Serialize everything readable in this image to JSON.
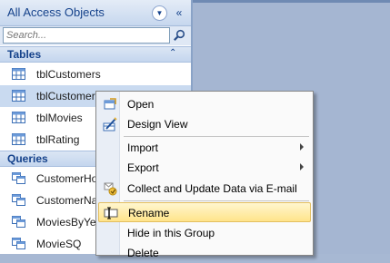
{
  "nav": {
    "title": "All Access Objects",
    "menu_icon": "chevron-down-icon",
    "collapse_icon": "double-chevron-left-icon",
    "search_placeholder": "Search...",
    "groups": [
      {
        "label": "Tables",
        "items": [
          "tblCustomers",
          "tblCustomer…",
          "tblMovies",
          "tblRating"
        ],
        "selected_index": 1
      },
      {
        "label": "Queries",
        "items": [
          "CustomerHo…",
          "CustomerNa…",
          "MoviesByYea…",
          "MovieSQ"
        ]
      }
    ]
  },
  "context_menu": {
    "items": [
      {
        "label": "Open",
        "icon": "open-icon"
      },
      {
        "label": "Design View",
        "icon": "design-view-icon"
      },
      {
        "label": "Import",
        "submenu": true
      },
      {
        "label": "Export",
        "submenu": true
      },
      {
        "label": "Collect and Update Data via E-mail",
        "icon": "collect-data-icon"
      },
      {
        "label": "Rename",
        "icon": "rename-icon",
        "highlighted": true
      },
      {
        "label": "Hide in this Group"
      },
      {
        "label": "Delete"
      }
    ]
  },
  "colors": {
    "accent": "#15428b",
    "highlight": "#ffe48a",
    "workspace": "#a5b6d2"
  }
}
